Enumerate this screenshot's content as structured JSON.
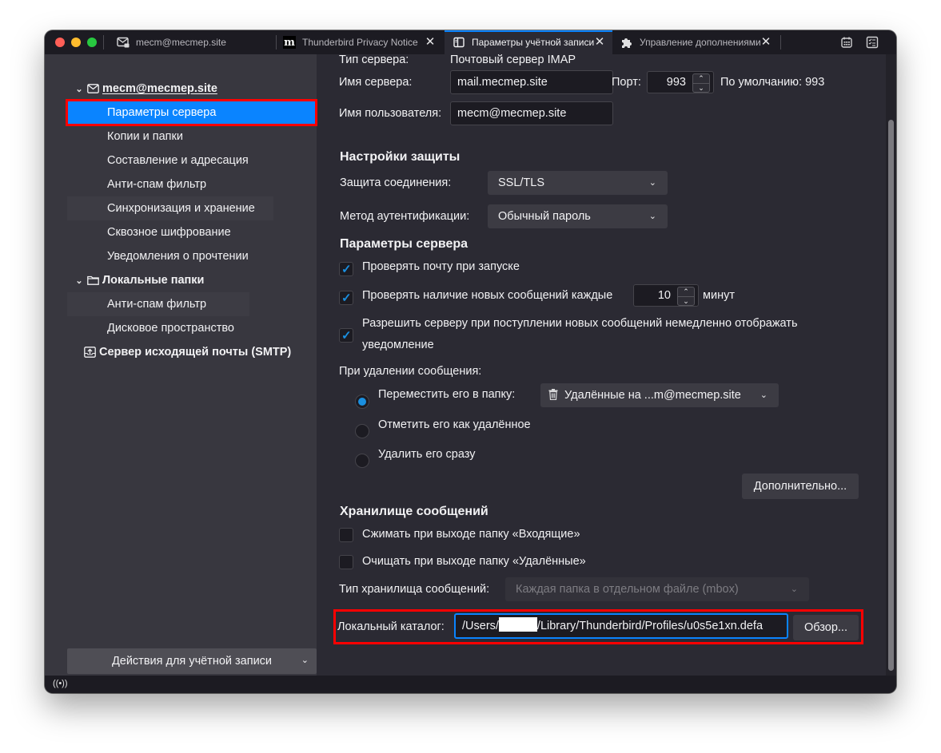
{
  "tabs": [
    {
      "label": "mecm@mecmep.site",
      "icon": "mail-lock-icon",
      "active": false,
      "closable": false
    },
    {
      "label": "Thunderbird Privacy Notice -",
      "icon": "mozilla-m-icon",
      "active": false,
      "closable": true
    },
    {
      "label": "Параметры учётной записи",
      "icon": "account-settings-icon",
      "active": true,
      "closable": true
    },
    {
      "label": "Управление дополнениями",
      "icon": "puzzle-icon",
      "active": false,
      "closable": true
    }
  ],
  "toolbar_icons": [
    "calendar-icon",
    "tasks-icon"
  ],
  "sidebar": {
    "account": {
      "label": "mecm@mecmep.site",
      "icon": "envelope-icon"
    },
    "account_items": [
      {
        "label": "Параметры сервера",
        "selected": true
      },
      {
        "label": "Копии и папки"
      },
      {
        "label": "Составление и адресация"
      },
      {
        "label": "Анти-спам фильтр"
      },
      {
        "label": "Синхронизация и хранение"
      },
      {
        "label": "Сквозное шифрование"
      },
      {
        "label": "Уведомления о прочтении"
      }
    ],
    "local": {
      "label": "Локальные папки",
      "icon": "folder-icon"
    },
    "local_items": [
      {
        "label": "Анти-спам фильтр"
      },
      {
        "label": "Дисковое пространство"
      }
    ],
    "smtp": {
      "label": "Сервер исходящей почты (SMTP)",
      "icon": "outbox-icon"
    },
    "actions_button": "Действия для учётной записи"
  },
  "server": {
    "type_label": "Тип сервера:",
    "type_value": "Почтовый сервер IMAP",
    "name_label": "Имя сервера:",
    "name_value": "mail.mecmep.site",
    "port_label": "Порт:",
    "port_value": "993",
    "default_label": "По умолчанию: 993",
    "user_label": "Имя пользователя:",
    "user_value": "mecm@mecmep.site"
  },
  "security": {
    "heading": "Настройки защиты",
    "conn_label": "Защита соединения:",
    "conn_value": "SSL/TLS",
    "auth_label": "Метод аутентификации:",
    "auth_value": "Обычный пароль"
  },
  "server_settings": {
    "heading": "Параметры сервера",
    "check_on_start": {
      "label": "Проверять почту при запуске",
      "checked": true
    },
    "check_every": {
      "label": "Проверять наличие новых сообщений каждые",
      "checked": true,
      "value": "10",
      "unit": "минут"
    },
    "push": {
      "label_line1": "Разрешить серверу при поступлении новых сообщений немедленно отображать",
      "label_line2": "уведомление",
      "checked": true
    },
    "delete_label": "При удалении сообщения:",
    "delete_options": [
      {
        "label": "Переместить его в папку:",
        "selected": true
      },
      {
        "label": "Отметить его как удалённое",
        "selected": false
      },
      {
        "label": "Удалить его сразу",
        "selected": false
      }
    ],
    "trash_folder": "Удалённые на ...m@mecmep.site",
    "advanced_button": "Дополнительно..."
  },
  "storage": {
    "heading": "Хранилище сообщений",
    "compact_inbox": {
      "label": "Сжимать при выходе папку «Входящие»",
      "checked": false
    },
    "empty_trash": {
      "label": "Очищать при выходе папку «Удалённые»",
      "checked": false
    },
    "type_label": "Тип хранилища сообщений:",
    "type_value": "Каждая папка в отдельном файле (mbox)",
    "local_dir_label": "Локальный каталог:",
    "local_dir_prefix": "/Users/",
    "local_dir_suffix": "/Library/Thunderbird/Profiles/u0s5e1xn.defa",
    "browse_button": "Обзор..."
  },
  "status_bar": {
    "icon": "online-status-icon"
  }
}
